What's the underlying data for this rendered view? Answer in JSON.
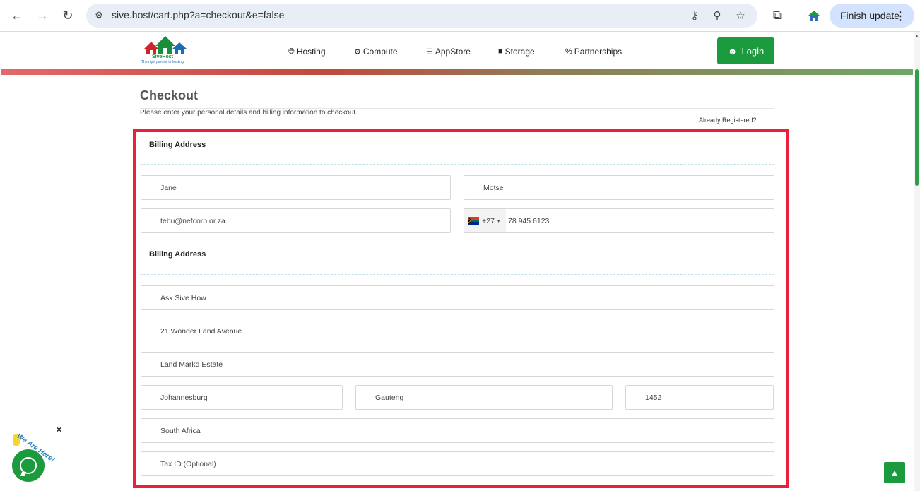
{
  "browser": {
    "url": "sive.host/cart.php?a=checkout&e=false",
    "finish_update_label": "Finish update"
  },
  "header": {
    "logo_name": "SiveHost",
    "logo_tagline": "The right partner in hosting.",
    "nav": [
      {
        "label": "Hosting",
        "icon": "globe-icon"
      },
      {
        "label": "Compute",
        "icon": "gear-icon"
      },
      {
        "label": "AppStore",
        "icon": "database-icon"
      },
      {
        "label": "Storage",
        "icon": "cube-icon"
      },
      {
        "label": "Partnerships",
        "icon": "percent-icon"
      }
    ],
    "login_label": "Login"
  },
  "checkout": {
    "title": "Checkout",
    "subtitle": "Please enter your personal details and billing information to checkout.",
    "already_registered": "Already Registered?",
    "section1_title": "Billing Address",
    "section2_title": "Billing Address",
    "first_name": "Jane",
    "last_name": "Motse",
    "email": "tebu@nefcorp.or.za",
    "phone_code": "+27",
    "phone_number": "78 945 6123",
    "company": "Ask Sive How",
    "address1": "21  Wonder Land Avenue",
    "address2": "Land Markd Estate",
    "city": "Johannesburg",
    "state": "Gauteng",
    "postcode": "1452",
    "country": "South Africa",
    "tax_id": "Tax ID (Optional)"
  },
  "chat": {
    "label": "We Are Here!",
    "close": "×"
  },
  "colors": {
    "brand_green": "#1c9a3e",
    "highlight_red": "#e8203a"
  }
}
